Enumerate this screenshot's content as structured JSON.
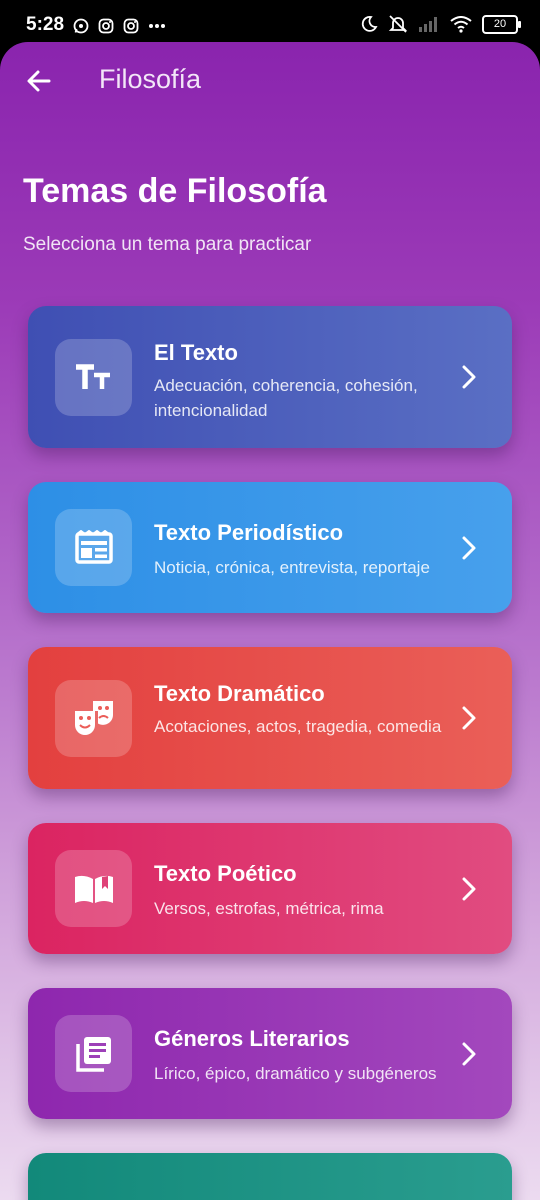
{
  "status_bar": {
    "time": "5:28",
    "battery": "20",
    "left_icons": [
      "whatsapp-icon",
      "instagram-icon",
      "instagram-icon",
      "more-dots-icon"
    ],
    "right_icons": [
      "moon-icon",
      "mute-icon",
      "signal-icon",
      "wifi-icon",
      "battery-icon"
    ]
  },
  "app_bar": {
    "title": "Filosofía",
    "back_icon": "arrow-left-icon"
  },
  "header": {
    "title": "Temas de Filosofía",
    "subtitle": "Selecciona un tema para practicar"
  },
  "topics": [
    {
      "title": "El Texto",
      "description": "Adecuación, coherencia, cohesión, intencionalidad",
      "icon": "text-size-icon",
      "color_start": "#3f4fb3",
      "color_end": "#5a6fc4"
    },
    {
      "title": "Texto Periodístico",
      "description": "Noticia, crónica, entrevista, reportaje",
      "icon": "newspaper-icon",
      "color_start": "#2d8fe6",
      "color_end": "#47a0ec"
    },
    {
      "title": "Texto Dramático",
      "description": "Acotaciones, actos, tragedia, comedia",
      "icon": "theater-masks-icon",
      "color_start": "#e3403f",
      "color_end": "#ea5f58"
    },
    {
      "title": "Texto Poético",
      "description": "Versos, estrofas, métrica, rima",
      "icon": "open-book-icon",
      "color_start": "#db2461",
      "color_end": "#e14c80"
    },
    {
      "title": "Géneros Literarios",
      "description": "Lírico, épico, dramático y subgéneros",
      "icon": "library-books-icon",
      "color_start": "#8e27ae",
      "color_end": "#a348bd"
    },
    {
      "title": "",
      "description": "",
      "icon": "",
      "color_start": "#12897a",
      "color_end": "#2a9d8f"
    }
  ]
}
